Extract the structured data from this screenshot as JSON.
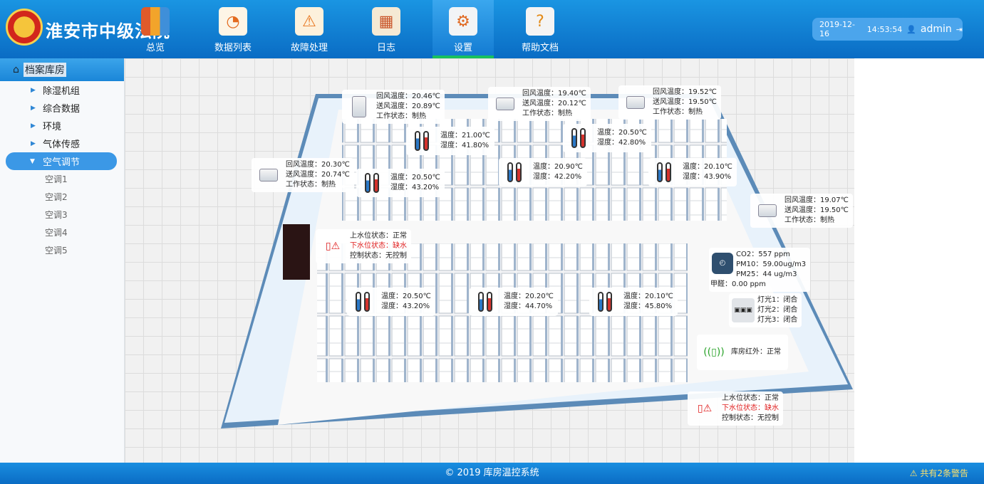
{
  "header": {
    "title": "淮安市中级法院",
    "date": "2019-12-16",
    "time": "14:53:54",
    "user": "admin",
    "nav": [
      {
        "label": "总览",
        "icon": "books-icon",
        "active": false
      },
      {
        "label": "数据列表",
        "icon": "data-list-icon",
        "active": false
      },
      {
        "label": "故障处理",
        "icon": "fault-warning-icon",
        "active": false
      },
      {
        "label": "日志",
        "icon": "calendar-icon",
        "active": false
      },
      {
        "label": "设置",
        "icon": "gear-icon",
        "active": true
      },
      {
        "label": "帮助文档",
        "icon": "help-doc-icon",
        "active": false
      }
    ]
  },
  "sidebar": {
    "root": "档案库房",
    "items": [
      {
        "label": "除湿机组"
      },
      {
        "label": "综合数据"
      },
      {
        "label": "环境"
      },
      {
        "label": "气体传感"
      },
      {
        "label": "空气调节"
      }
    ],
    "sub": [
      "空调1",
      "空调2",
      "空调3",
      "空调4",
      "空调5"
    ]
  },
  "cards": {
    "ac1": [
      "回风温度：20.46℃",
      "送风温度：20.89℃",
      "工作状态：制热"
    ],
    "ac2": [
      "回风温度：19.40℃",
      "送风温度：20.12℃",
      "工作状态：制热"
    ],
    "ac3": [
      "回风温度：19.52℃",
      "送风温度：19.50℃",
      "工作状态：制热"
    ],
    "ac4": [
      "回风温度：20.30℃",
      "送风温度：20.74℃",
      "工作状态：制热"
    ],
    "ac5": [
      "回风温度：19.07℃",
      "送风温度：19.50℃",
      "工作状态：制热"
    ],
    "th1": [
      "温度：21.00℃",
      "湿度：41.80%"
    ],
    "th2": [
      "温度：20.50℃",
      "湿度：42.80%"
    ],
    "th3": [
      "温度：20.50℃",
      "湿度：43.20%"
    ],
    "th4": [
      "温度：20.90℃",
      "湿度：42.20%"
    ],
    "th5": [
      "温度：20.10℃",
      "湿度：43.90%"
    ],
    "th6": [
      "温度：20.50℃",
      "湿度：43.20%"
    ],
    "th7": [
      "温度：20.20℃",
      "湿度：44.70%"
    ],
    "th8": [
      "温度：20.10℃",
      "湿度：45.80%"
    ],
    "water1": [
      "上水位状态：正常",
      "下水位状态：缺水",
      "控制状态：无控制"
    ],
    "water2": [
      "上水位状态：正常",
      "下水位状态：缺水",
      "控制状态：无控制"
    ],
    "gas": [
      "CO2：557 ppm",
      "PM10：59.00ug/m3",
      "PM25：44 ug/m3",
      "甲醛：0.00 ppm"
    ],
    "light": [
      "灯光1：闭合",
      "灯光2：闭合",
      "灯光3：闭合"
    ],
    "ir": "库房红外：正常"
  },
  "footer": {
    "copyright": "© 2019  库房温控系统",
    "warning": "共有2条警告"
  }
}
